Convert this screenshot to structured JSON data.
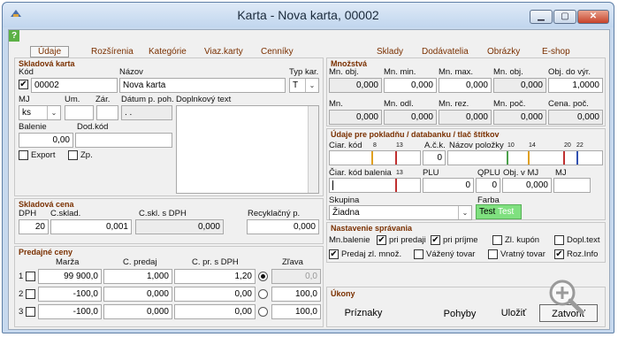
{
  "window": {
    "title": "Karta - Nova karta, 00002",
    "help": "?"
  },
  "tabs": [
    "Údaje",
    "Rozšírenia",
    "Kategórie",
    "Viaz.karty",
    "Cenníky",
    "Sklady",
    "Dodávatelia",
    "Obrázky",
    "E-shop"
  ],
  "skladova_karta": {
    "title": "Skladová karta",
    "kod_label": "Kód",
    "kod_value": "00002",
    "nazov_label": "Názov",
    "nazov_value": "Nova karta",
    "typ_label": "Typ kar.",
    "typ_value": "T",
    "mj_label": "MJ",
    "mj_value": "ks",
    "um_label": "Um.",
    "zar_label": "Zár.",
    "datum_label": "Dátum p. poh.",
    "datum_value": ". .",
    "doplnkovy_label": "Doplnkový text",
    "balenie_label": "Balenie",
    "balenie_value": "0,00",
    "dodkod_label": "Dod.kód",
    "export_label": "Export",
    "zp_label": "Zp."
  },
  "skladova_cena": {
    "title": "Skladová cena",
    "dph_label": "DPH",
    "dph_value": "20",
    "csklad_label": "C.sklad.",
    "csklad_value": "0,001",
    "csklsdph_label": "C.skl. s DPH",
    "csklsdph_value": "0,000",
    "recykl_label": "Recyklačný p.",
    "recykl_value": "0,000"
  },
  "predajne_ceny": {
    "title": "Predajné ceny",
    "headers": [
      "Marža",
      "C. predaj",
      "C. pr. s DPH",
      "Zľava"
    ],
    "rows": [
      {
        "num": "1",
        "marza": "99 900,0",
        "predaj": "1,000",
        "sdph": "1,20",
        "zlava": "0,0"
      },
      {
        "num": "2",
        "marza": "-100,0",
        "predaj": "0,000",
        "sdph": "0,00",
        "zlava": "100,0"
      },
      {
        "num": "3",
        "marza": "-100,0",
        "predaj": "0,000",
        "sdph": "0,00",
        "zlava": "100,0"
      }
    ]
  },
  "mnozstva": {
    "title": "Množstvá",
    "row1": [
      {
        "label": "Mn. obj.",
        "value": "0,000"
      },
      {
        "label": "Mn. min.",
        "value": "0,000"
      },
      {
        "label": "Mn. max.",
        "value": "0,000"
      },
      {
        "label": "Mn. obj.",
        "value": "0,000"
      },
      {
        "label": "Obj. do výr.",
        "value": "1,0000"
      }
    ],
    "row2": [
      {
        "label": "Mn.",
        "value": "0,000"
      },
      {
        "label": "Mn. odl.",
        "value": "0,000"
      },
      {
        "label": "Mn. rez.",
        "value": "0,000"
      },
      {
        "label": "Mn. poč.",
        "value": "0,000"
      },
      {
        "label": "Cena. poč.",
        "value": "0,000"
      }
    ]
  },
  "pokladna": {
    "title": "Údaje pre pokladňu / databanku / tlač štítkov",
    "ciarkod_label": "Ciar. kód",
    "ciar_ticks": [
      "8",
      "13"
    ],
    "ack_label": "A.č.k.",
    "ack_value": "0",
    "nazov_polozky_label": "Názov položky",
    "nazov_ticks": [
      "10",
      "14",
      "20",
      "22"
    ],
    "ciarkod_balenia_label": "Čiar. kód balenia",
    "balenia_ticks": [
      "13"
    ],
    "plu_label": "PLU",
    "plu_value": "0",
    "qplu_label": "QPLU",
    "qplu_value": "0",
    "objvmj_label": "Obj. v MJ",
    "objvmj_value": "0,000",
    "mj2_label": "MJ",
    "skupina_label": "Skupina",
    "skupina_value": "Žiadna",
    "farba_label": "Farba",
    "farba_text1": "Test",
    "farba_text2": "Test"
  },
  "nastavenie": {
    "title": "Nastavenie správania",
    "mnbalenie_label": "Mn.balenie",
    "pri_predaji": "pri predaji",
    "pri_prijme": "pri príjme",
    "zl_kupon": "Zl. kupón",
    "dopl_text": "Dopl.text",
    "predaj_zl": "Predaj zl. množ.",
    "vazeny": "Vážený tovar",
    "vratny": "Vratný tovar",
    "roz_info": "Roz.Info"
  },
  "ukony": {
    "title": "Úkony"
  },
  "buttons": {
    "priznaky": "Príznaky",
    "pohyby": "Pohyby",
    "ulozit": "Uložiť",
    "zatvorit": "Zatvoriť"
  }
}
